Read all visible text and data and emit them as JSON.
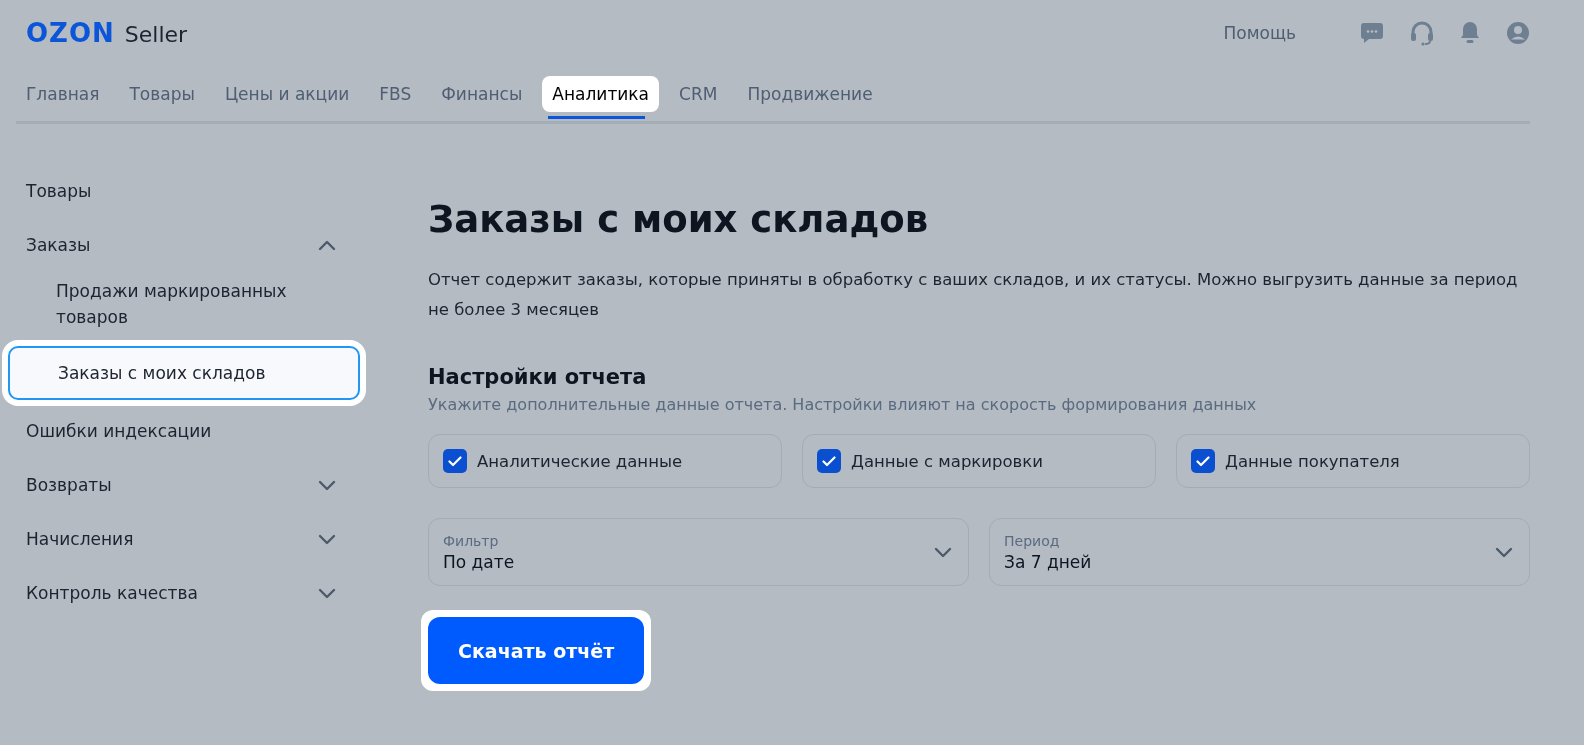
{
  "logo": {
    "brand": "OZON",
    "product": "Seller"
  },
  "header": {
    "help": "Помощь"
  },
  "tabs": [
    {
      "label": "Главная",
      "selected": false
    },
    {
      "label": "Товары",
      "selected": false
    },
    {
      "label": "Цены и акции",
      "selected": false
    },
    {
      "label": "FBS",
      "selected": false
    },
    {
      "label": "Финансы",
      "selected": false
    },
    {
      "label": "Аналитика",
      "selected": true
    },
    {
      "label": "CRM",
      "selected": false
    },
    {
      "label": "Продвижение",
      "selected": false
    }
  ],
  "sidebar": {
    "items": [
      {
        "kind": "link",
        "label": "Товары",
        "selected": false
      },
      {
        "kind": "group",
        "label": "Заказы",
        "expanded": true,
        "children": [
          {
            "label": "Продажи маркированных товаров",
            "selected": false
          },
          {
            "label": "Заказы с моих складов",
            "selected": true
          }
        ]
      },
      {
        "kind": "link",
        "label": "Ошибки индексации",
        "selected": false
      },
      {
        "kind": "group",
        "label": "Возвраты",
        "expanded": false
      },
      {
        "kind": "group",
        "label": "Начисления",
        "expanded": false
      },
      {
        "kind": "group",
        "label": "Контроль качества",
        "expanded": false
      }
    ]
  },
  "main": {
    "title": "Заказы с моих складов",
    "description": "Отчет содержит заказы, которые приняты в обработку с ваших складов, и их статусы. Можно выгрузить данные за период не более 3 месяцев",
    "settings": {
      "title": "Настройки отчета",
      "hint": "Укажите дополнительные данные отчета. Настройки влияют на скорость формирования данных",
      "checkboxes": [
        {
          "label": "Аналитические данные",
          "checked": true
        },
        {
          "label": "Данные с маркировки",
          "checked": true
        },
        {
          "label": "Данные покупателя",
          "checked": true
        }
      ],
      "selects": [
        {
          "label": "Фильтр",
          "value": "По дате"
        },
        {
          "label": "Период",
          "value": "За 7 дней"
        }
      ]
    },
    "download_button": "Скачать отчёт"
  }
}
